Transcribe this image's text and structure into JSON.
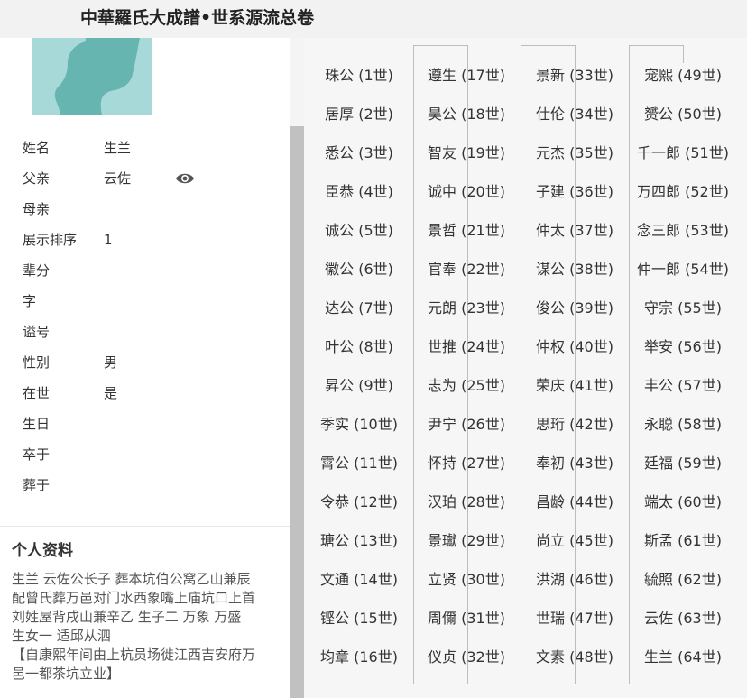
{
  "header": {
    "title": "中華羅氏大成譜•世系源流总卷"
  },
  "avatar": {
    "accent_color": "#a7d9d8"
  },
  "profile": [
    {
      "label": "姓名",
      "value": "生兰"
    },
    {
      "label": "父亲",
      "value": "云佐",
      "icon": "eye-icon"
    },
    {
      "label": "母亲",
      "value": ""
    },
    {
      "label": "展示排序",
      "value": "1"
    },
    {
      "label": "辈分",
      "value": ""
    },
    {
      "label": "字",
      "value": ""
    },
    {
      "label": "谥号",
      "value": ""
    },
    {
      "label": "性别",
      "value": "男"
    },
    {
      "label": "在世",
      "value": "是"
    },
    {
      "label": "生日",
      "value": ""
    },
    {
      "label": "卒于",
      "value": ""
    },
    {
      "label": "葬于",
      "value": ""
    }
  ],
  "bio": {
    "title": "个人资料",
    "lines": [
      "生兰  云佐公长子 葬本坑伯公窝乙山兼辰",
      "配曾氏葬万邑对门水西象嘴上庙坑口上首",
      "刘姓屋背戌山兼辛乙  生子二  万象 万盛",
      "生女一  适邱从泗",
      "【自康熙年间由上杭员场徙江西吉安府万",
      "邑一都茶坑立业】"
    ]
  },
  "generations": [
    [
      "珠公 (1世)",
      "居厚 (2世)",
      "悉公 (3世)",
      "臣恭 (4世)",
      "诚公 (5世)",
      "徽公 (6世)",
      "达公 (7世)",
      "叶公 (8世)",
      "昇公 (9世)",
      "季实 (10世)",
      "霄公 (11世)",
      "令恭 (12世)",
      "瑭公 (13世)",
      "文通 (14世)",
      "铿公 (15世)",
      "均章 (16世)"
    ],
    [
      "遵生 (17世)",
      "昊公 (18世)",
      "智友 (19世)",
      "诚中 (20世)",
      "景哲 (21世)",
      "官奉 (22世)",
      "元朗 (23世)",
      "世推 (24世)",
      "志为 (25世)",
      "尹宁 (26世)",
      "怀持 (27世)",
      "汉珀 (28世)",
      "景瓛 (29世)",
      "立贤 (30世)",
      "周儞 (31世)",
      "仪贞 (32世)"
    ],
    [
      "景新 (33世)",
      "仕伦 (34世)",
      "元杰 (35世)",
      "子建 (36世)",
      "仲太 (37世)",
      "谋公 (38世)",
      "俊公 (39世)",
      "仲权 (40世)",
      "荣庆 (41世)",
      "思珩 (42世)",
      "奉初 (43世)",
      "昌龄 (44世)",
      "尚立 (45世)",
      "洪湖 (46世)",
      "世瑞 (47世)",
      "文素 (48世)"
    ],
    [
      "宠熙 (49世)",
      "赟公 (50世)",
      "千一郎 (51世)",
      "万四郎 (52世)",
      "念三郎 (53世)",
      "仲一郎 (54世)",
      "守宗 (55世)",
      "举安 (56世)",
      "丰公 (57世)",
      "永聪 (58世)",
      "廷福 (59世)",
      "端太 (60世)",
      "斯孟 (61世)",
      "毓照 (62世)",
      "云佐 (63世)",
      "生兰 (64世)"
    ]
  ]
}
